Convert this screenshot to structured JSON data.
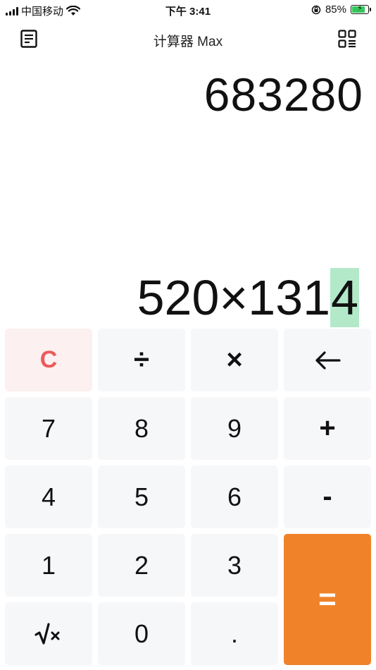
{
  "status_bar": {
    "carrier": "中国移动",
    "time": "下午 3:41",
    "battery_percent": "85%",
    "battery_level": 0.85,
    "icons": [
      "signal-icon",
      "wifi-icon",
      "orientation-lock-icon",
      "battery-charging-icon"
    ]
  },
  "nav": {
    "title": "计算器 Max",
    "left_icon": "history-icon",
    "right_icon": "grid-menu-icon"
  },
  "display": {
    "result": "683280",
    "expression_prefix": "520×131",
    "expression_cursor_char": "4",
    "cursor_highlight_color": "#b3e9c9"
  },
  "keypad": {
    "clear": "C",
    "divide": "÷",
    "multiply": "×",
    "backspace_icon": "backspace-arrow-icon",
    "seven": "7",
    "eight": "8",
    "nine": "9",
    "plus": "+",
    "four": "4",
    "five": "5",
    "six": "6",
    "minus": "-",
    "one": "1",
    "two": "2",
    "three": "3",
    "equals": "=",
    "sqrt_icon": "square-root-icon",
    "zero": "0",
    "dot": "."
  },
  "colors": {
    "clear_text": "#ec5a5a",
    "clear_bg": "#fdf0f1",
    "equals_bg": "#f08329",
    "key_bg": "#f6f7f9"
  }
}
